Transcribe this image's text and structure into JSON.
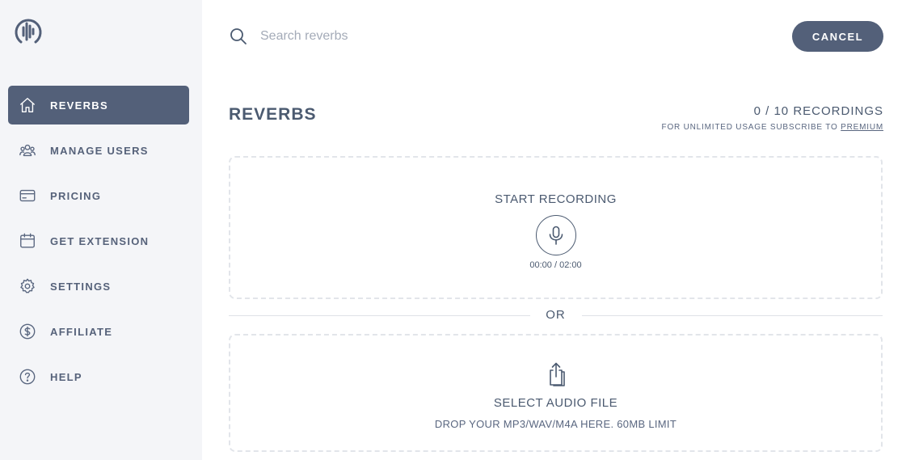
{
  "sidebar": {
    "logo": "soundwave-logo-icon",
    "items": [
      {
        "label": "REVERBS",
        "icon": "home-icon",
        "active": true
      },
      {
        "label": "MANAGE USERS",
        "icon": "users-icon",
        "active": false
      },
      {
        "label": "PRICING",
        "icon": "credit-card-icon",
        "active": false
      },
      {
        "label": "GET EXTENSION",
        "icon": "calendar-icon",
        "active": false
      },
      {
        "label": "SETTINGS",
        "icon": "gear-icon",
        "active": false
      },
      {
        "label": "AFFILIATE",
        "icon": "dollar-icon",
        "active": false
      },
      {
        "label": "HELP",
        "icon": "help-icon",
        "active": false
      }
    ]
  },
  "header": {
    "search_placeholder": "Search reverbs",
    "cancel_label": "CANCEL"
  },
  "main": {
    "title": "REVERBS",
    "recording_count": "0 / 10 RECORDINGS",
    "subscribe_note": "FOR UNLIMITED USAGE SUBSCRIBE TO ",
    "premium_link": "PREMIUM",
    "recorder": {
      "title": "START RECORDING",
      "timer": "00:00 / 02:00",
      "icon": "microphone-icon"
    },
    "divider_text": "OR",
    "upload": {
      "title": "SELECT AUDIO FILE",
      "subtitle": "DROP YOUR MP3/WAV/M4A HERE. 60MB LIMIT",
      "icon": "upload-icon"
    }
  },
  "colors": {
    "accent": "#536079",
    "sidebar_bg": "#f4f5f8",
    "text": "#4b5a70",
    "dashed_border": "#e2e5ea"
  }
}
